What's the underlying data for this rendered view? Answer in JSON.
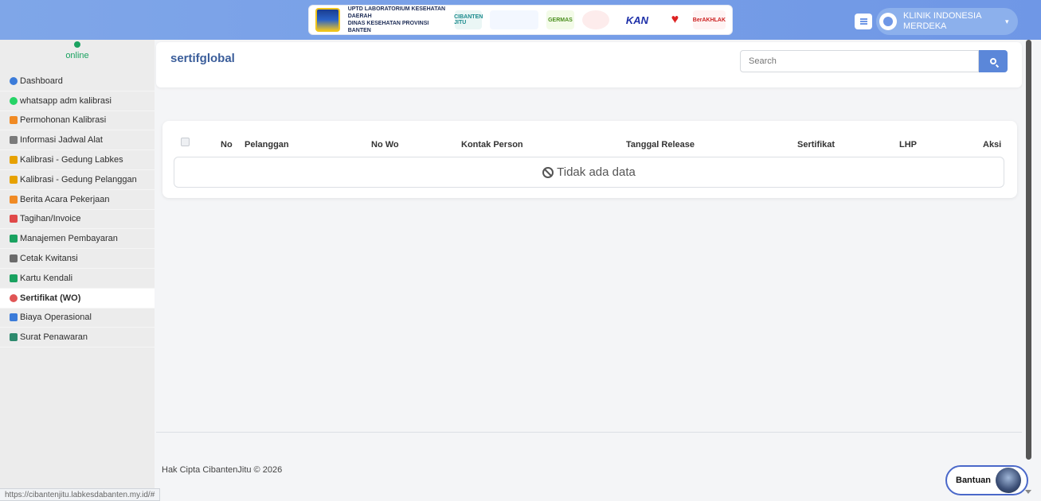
{
  "header": {
    "banner_org_line1": "UPTD LABORATORIUM KESEHATAN DAERAH",
    "banner_org_line2": "DINAS KESEHATAN PROVINSI BANTEN",
    "banner_cibanten": "CIBANTEN JITU",
    "banner_germas": "GERMAS",
    "banner_kan": "KAN",
    "banner_berakhlak": "BerAKHLAK",
    "user_name": "KLINIK INDONESIA MERDEKA",
    "accent_color": "#6f97e6"
  },
  "sidebar": {
    "status": "online",
    "items": [
      {
        "label": "Dashboard",
        "icon": "dashboard-icon",
        "color": "#3b7bd9"
      },
      {
        "label": "whatsapp adm kalibrasi",
        "icon": "whatsapp-icon",
        "color": "#25d366"
      },
      {
        "label": "Permohonan Kalibrasi",
        "icon": "folder-icon",
        "color": "#f08a24"
      },
      {
        "label": "Informasi Jadwal Alat",
        "icon": "calendar-icon",
        "color": "#7a7a7a"
      },
      {
        "label": "Kalibrasi - Gedung Labkes",
        "icon": "upload-icon",
        "color": "#e6a100"
      },
      {
        "label": "Kalibrasi - Gedung Pelanggan",
        "icon": "upload-icon",
        "color": "#e6a100"
      },
      {
        "label": "Berita Acara Pekerjaan",
        "icon": "folder-icon",
        "color": "#f08a24"
      },
      {
        "label": "Tagihan/Invoice",
        "icon": "invoice-icon",
        "color": "#e04848"
      },
      {
        "label": "Manajemen Pembayaran",
        "icon": "money-icon",
        "color": "#1aa260"
      },
      {
        "label": "Cetak Kwitansi",
        "icon": "print-icon",
        "color": "#6b6b6b"
      },
      {
        "label": "Kartu Kendali",
        "icon": "card-icon",
        "color": "#1aa260"
      },
      {
        "label": "Sertifikat (WO)",
        "icon": "certificate-icon",
        "color": "#e05555"
      },
      {
        "label": "Biaya Operasional",
        "icon": "calculator-icon",
        "color": "#3b7bd9"
      },
      {
        "label": "Surat Penawaran",
        "icon": "send-icon",
        "color": "#2d8a6d"
      }
    ]
  },
  "main": {
    "title": "sertifglobal",
    "search_placeholder": "Search",
    "columns": [
      "No",
      "Pelanggan",
      "No Wo",
      "Kontak Person",
      "Tanggal Release",
      "Sertifikat",
      "LHP",
      "Aksi"
    ],
    "empty_text": "Tidak ada data"
  },
  "footer": {
    "copyright": "Hak Cipta CibantenJitu © 2026",
    "status_url": "https://cibantenjitu.labkesdabanten.my.id/#",
    "help_label": "Bantuan"
  }
}
